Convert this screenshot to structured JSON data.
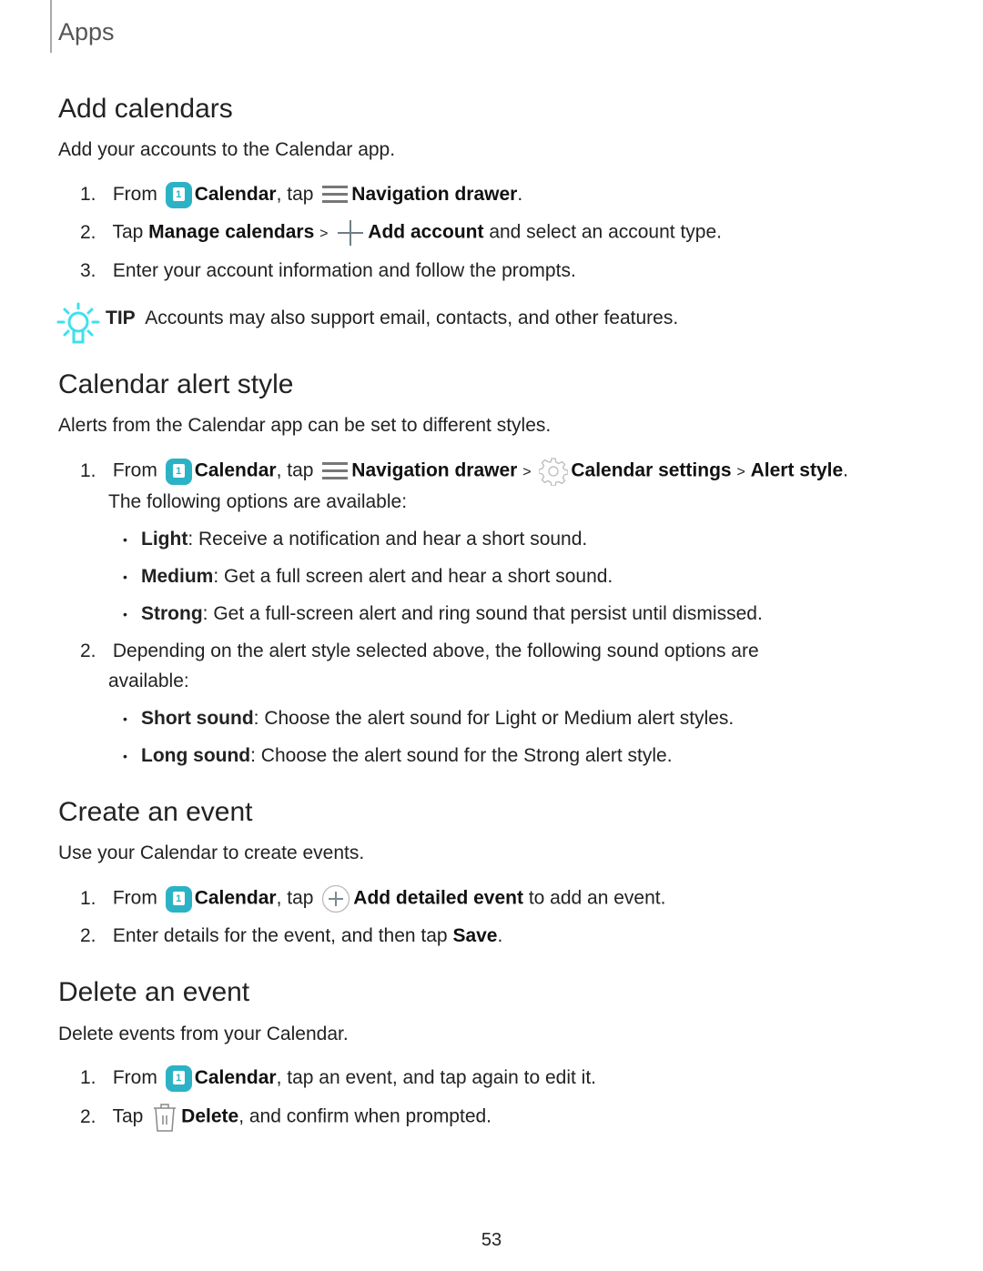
{
  "header": {
    "section": "Apps"
  },
  "sections": [
    {
      "title": "Add calendars",
      "intro": "Add your accounts to the Calendar app.",
      "steps": [
        {
          "num": "1.",
          "parts": [
            "From",
            "Calendar",
            ", tap",
            "Navigation drawer",
            "."
          ]
        },
        {
          "num": "2.",
          "parts": [
            "Tap",
            "Manage calendars",
            ">",
            "Add account",
            "and select an account type."
          ]
        },
        {
          "num": "3.",
          "text": "Enter your account information and follow the prompts."
        }
      ],
      "tip": {
        "label": "TIP",
        "text": "Accounts may also support email, contacts, and other features."
      }
    },
    {
      "title": "Calendar alert style",
      "intro": "Alerts from the Calendar app can be set to different styles.",
      "steps": [
        {
          "num": "1.",
          "parts": [
            "From",
            "Calendar",
            ", tap",
            "Navigation drawer",
            ">",
            "Calendar settings",
            ">",
            "Alert style",
            "."
          ],
          "continuation": "The following options are available:",
          "bullets": [
            {
              "term": "Light",
              "text": ": Receive a notification and hear a short sound."
            },
            {
              "term": "Medium",
              "text": ": Get a full screen alert and hear a short sound."
            },
            {
              "term": "Strong",
              "text": ": Get a full-screen alert and ring sound that persist until dismissed."
            }
          ]
        },
        {
          "num": "2.",
          "text": "Depending on the alert style selected above, the following sound options are",
          "continuation": "available:",
          "bullets": [
            {
              "term": "Short sound",
              "text": ": Choose the alert sound for Light or Medium alert styles."
            },
            {
              "term": "Long sound",
              "text": ": Choose the alert sound for the Strong alert style."
            }
          ]
        }
      ]
    },
    {
      "title": "Create an event",
      "intro": "Use your Calendar to create events.",
      "steps": [
        {
          "num": "1.",
          "parts": [
            "From",
            "Calendar",
            ", tap",
            "Add detailed event",
            "to add an event."
          ]
        },
        {
          "num": "2.",
          "parts": [
            "Enter details for the event, and then tap",
            "Save",
            "."
          ]
        }
      ]
    },
    {
      "title": "Delete an event",
      "intro": "Delete events from your Calendar.",
      "steps": [
        {
          "num": "1.",
          "parts": [
            "From",
            "Calendar",
            ", tap an event, and tap again to edit it."
          ]
        },
        {
          "num": "2.",
          "parts": [
            "Tap",
            "Delete",
            ", and confirm when prompted."
          ]
        }
      ]
    }
  ],
  "icons": {
    "calendar_digit": "1"
  },
  "colors": {
    "calendar_icon": "#2bb3c5",
    "tip_icon": "#3ee0ee"
  },
  "footer": {
    "page_number": "53"
  }
}
